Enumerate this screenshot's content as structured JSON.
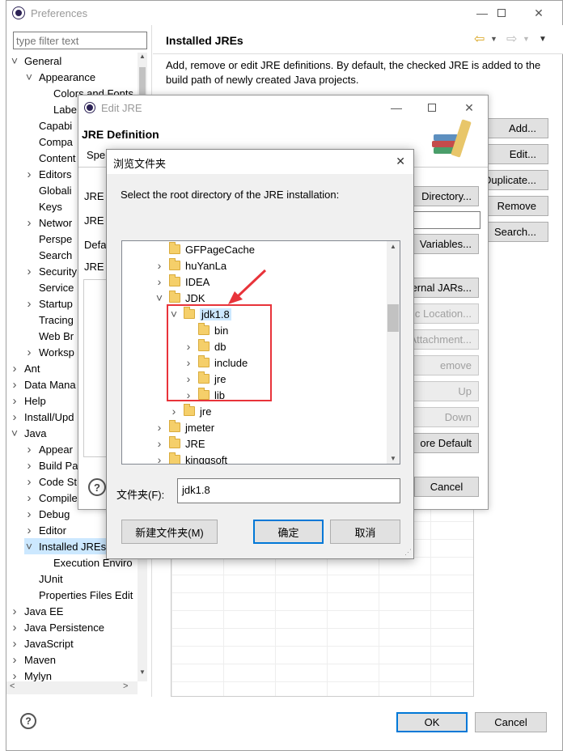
{
  "prefs": {
    "title": "Preferences",
    "filter_placeholder": "type filter text",
    "page_title": "Installed JREs",
    "description": "Add, remove or edit JRE definitions. By default, the checked JRE is added to the build path of newly created Java projects.",
    "ok": "OK",
    "cancel": "Cancel",
    "side_buttons": [
      "Add...",
      "Edit...",
      "Duplicate...",
      "Remove",
      "Search..."
    ],
    "tree": [
      {
        "label": "General",
        "level": 0,
        "state": "open"
      },
      {
        "label": "Appearance",
        "level": 1,
        "state": "open"
      },
      {
        "label": "Colors and Fonts",
        "level": 2,
        "state": "leaf"
      },
      {
        "label": "Labe",
        "level": 2,
        "state": "leaf"
      },
      {
        "label": "Capabi",
        "level": 1,
        "state": "leaf"
      },
      {
        "label": "Compa",
        "level": 1,
        "state": "leaf"
      },
      {
        "label": "Content",
        "level": 1,
        "state": "leaf"
      },
      {
        "label": "Editors",
        "level": 1,
        "state": "closed"
      },
      {
        "label": "Globali",
        "level": 1,
        "state": "leaf"
      },
      {
        "label": "Keys",
        "level": 1,
        "state": "leaf"
      },
      {
        "label": "Networ",
        "level": 1,
        "state": "closed"
      },
      {
        "label": "Perspe",
        "level": 1,
        "state": "leaf"
      },
      {
        "label": "Search",
        "level": 1,
        "state": "leaf"
      },
      {
        "label": "Security",
        "level": 1,
        "state": "closed"
      },
      {
        "label": "Service",
        "level": 1,
        "state": "leaf"
      },
      {
        "label": "Startup",
        "level": 1,
        "state": "closed"
      },
      {
        "label": "Tracing",
        "level": 1,
        "state": "leaf"
      },
      {
        "label": "Web Br",
        "level": 1,
        "state": "leaf"
      },
      {
        "label": "Worksp",
        "level": 1,
        "state": "closed"
      },
      {
        "label": "Ant",
        "level": 0,
        "state": "closed"
      },
      {
        "label": "Data Mana",
        "level": 0,
        "state": "closed"
      },
      {
        "label": "Help",
        "level": 0,
        "state": "closed"
      },
      {
        "label": "Install/Upd",
        "level": 0,
        "state": "closed"
      },
      {
        "label": "Java",
        "level": 0,
        "state": "open"
      },
      {
        "label": "Appear",
        "level": 1,
        "state": "closed"
      },
      {
        "label": "Build Pa",
        "level": 1,
        "state": "closed"
      },
      {
        "label": "Code St",
        "level": 1,
        "state": "closed"
      },
      {
        "label": "Compile",
        "level": 1,
        "state": "closed"
      },
      {
        "label": "Debug",
        "level": 1,
        "state": "closed"
      },
      {
        "label": "Editor",
        "level": 1,
        "state": "closed"
      },
      {
        "label": "Installed JREs",
        "level": 1,
        "state": "open",
        "selected": true
      },
      {
        "label": "Execution Enviro",
        "level": 2,
        "state": "leaf"
      },
      {
        "label": "JUnit",
        "level": 1,
        "state": "leaf"
      },
      {
        "label": "Properties Files Edit",
        "level": 1,
        "state": "leaf"
      },
      {
        "label": "Java EE",
        "level": 0,
        "state": "closed"
      },
      {
        "label": "Java Persistence",
        "level": 0,
        "state": "closed"
      },
      {
        "label": "JavaScript",
        "level": 0,
        "state": "closed"
      },
      {
        "label": "Maven",
        "level": 0,
        "state": "closed"
      },
      {
        "label": "Mylyn",
        "level": 0,
        "state": "closed"
      }
    ]
  },
  "edit_jre": {
    "title": "Edit JRE",
    "heading": "JRE Definition",
    "spec_label": "Spe",
    "left_labels": [
      "JRE l",
      "JRE r",
      "Defa",
      "JRE s"
    ],
    "buttons": [
      "Directory...",
      "Variables...",
      "ternal JARs...",
      "c Location...",
      "Attachment...",
      "emove",
      "Up",
      "Down",
      "ore Default"
    ],
    "cancel": "Cancel"
  },
  "browse": {
    "title": "浏览文件夹",
    "instruction": "Select the root directory of the JRE installation:",
    "folder_label": "文件夹(F):",
    "folder_value": "jdk1.8",
    "new_folder": "新建文件夹(M)",
    "ok": "确定",
    "cancel": "取消",
    "tree": [
      {
        "label": "GFPageCache",
        "level": 0,
        "state": "leaf"
      },
      {
        "label": "huYanLa",
        "level": 0,
        "state": "closed"
      },
      {
        "label": "IDEA",
        "level": 0,
        "state": "closed"
      },
      {
        "label": "JDK",
        "level": 0,
        "state": "open"
      },
      {
        "label": "jdk1.8",
        "level": 1,
        "state": "open",
        "selected": true
      },
      {
        "label": "bin",
        "level": 2,
        "state": "leaf"
      },
      {
        "label": "db",
        "level": 2,
        "state": "closed"
      },
      {
        "label": "include",
        "level": 2,
        "state": "closed"
      },
      {
        "label": "jre",
        "level": 2,
        "state": "closed"
      },
      {
        "label": "lib",
        "level": 2,
        "state": "closed"
      },
      {
        "label": "jre",
        "level": 1,
        "state": "closed"
      },
      {
        "label": "jmeter",
        "level": 0,
        "state": "closed"
      },
      {
        "label": "JRE",
        "level": 0,
        "state": "closed"
      },
      {
        "label": "kingqsoft",
        "level": 0,
        "state": "closed"
      }
    ]
  },
  "highlight_color": "#e8333a",
  "select_color": "#cce8ff"
}
